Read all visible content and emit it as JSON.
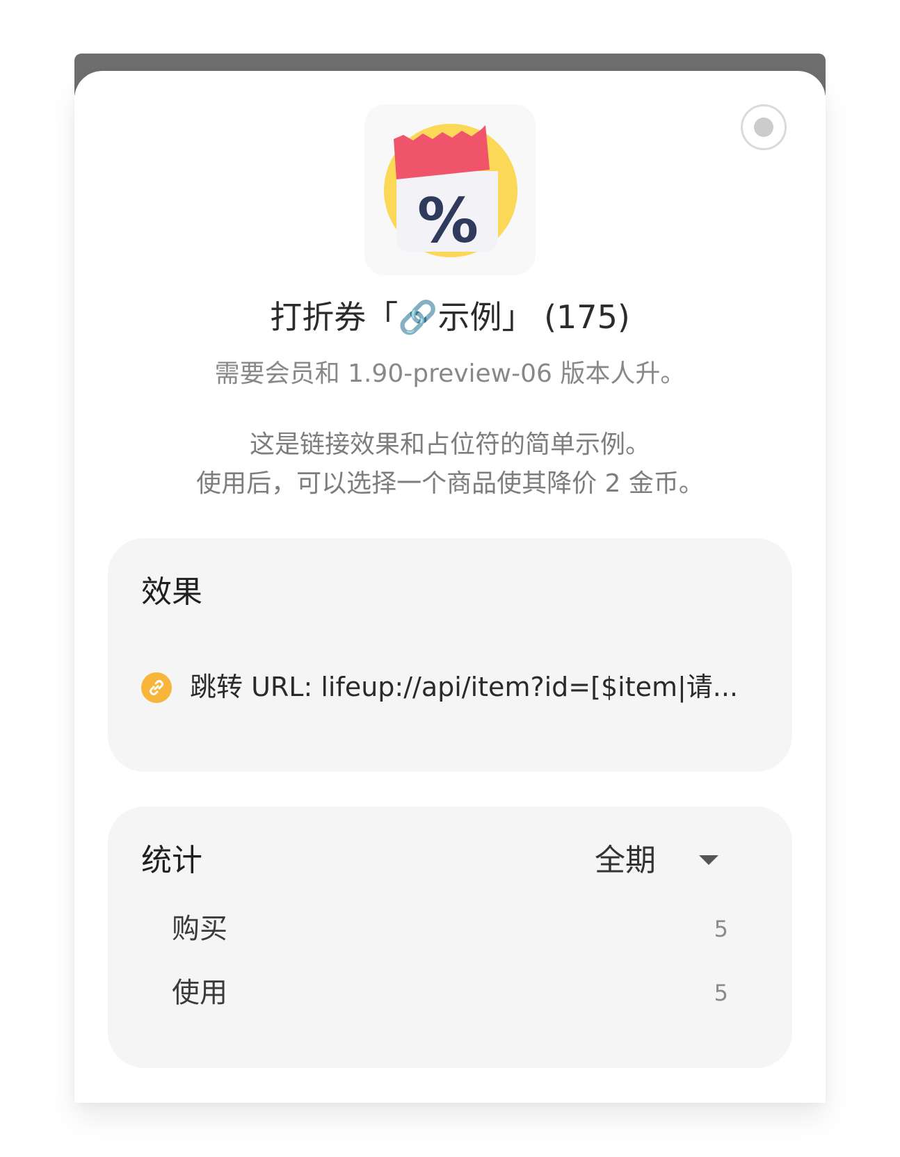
{
  "item": {
    "title_prefix": "打折券「",
    "title_link_glyph": "🔗",
    "title_name": "示例」",
    "title_count": " (175)",
    "icon_name": "discount-coupon-icon",
    "requirement": "需要会员和 1.90-preview-06 版本人升。",
    "description_lines": [
      "这是链接效果和占位符的简单示例。",
      "使用后，可以选择一个商品使其降价 2 金币。"
    ]
  },
  "effects": {
    "heading": "效果",
    "items": [
      {
        "icon": "link-icon",
        "text": "跳转 URL: lifeup://api/item?id=[$item|请..."
      }
    ]
  },
  "stats": {
    "heading": "统计",
    "period": "全期",
    "rows": [
      {
        "label": "购买",
        "value": "5"
      },
      {
        "label": "使用",
        "value": "5"
      }
    ]
  },
  "colors": {
    "accent_red": "#f0546a",
    "accent_yellow": "#fbd857",
    "icon_navy": "#2f3a5c",
    "link_orange": "#f7b53a",
    "panel_gray": "#f5f5f5"
  }
}
